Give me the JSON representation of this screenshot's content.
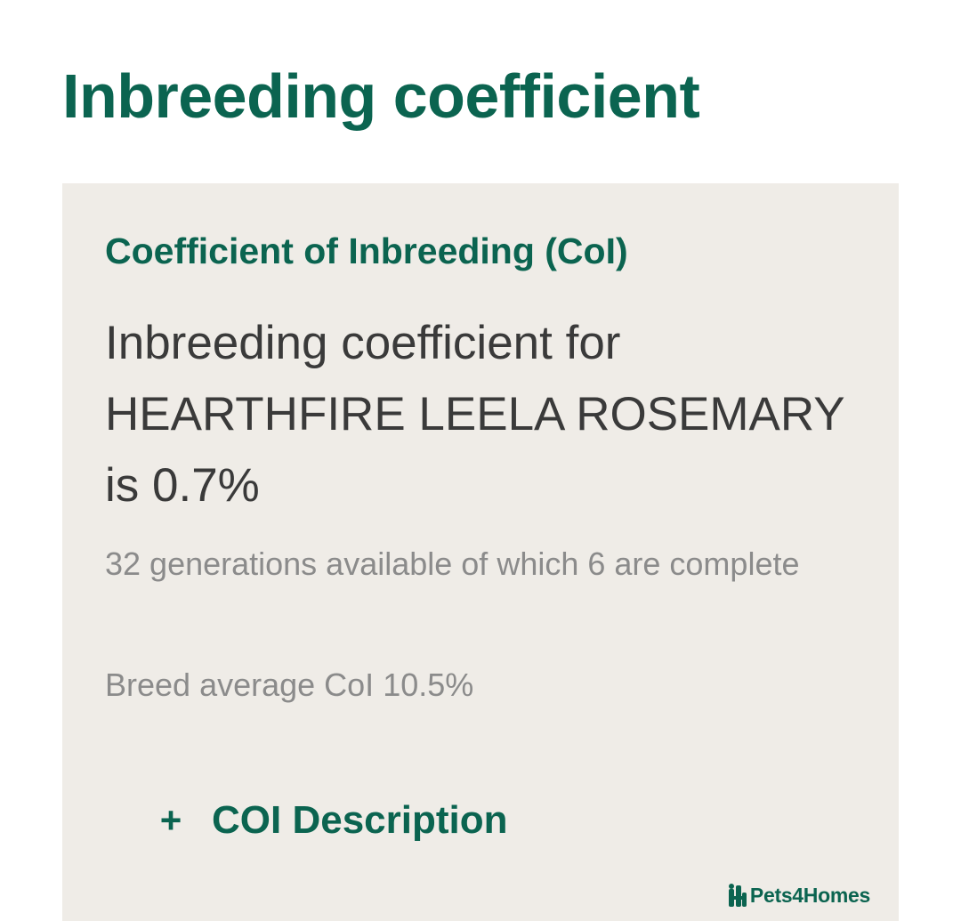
{
  "page": {
    "title": "Inbreeding coefficient"
  },
  "card": {
    "heading": "Coefficient of Inbreeding (CoI)",
    "statement": "Inbreeding coefficient for HEARTHFIRE LEELA ROSEMARY is 0.7%",
    "generations": "32 generations available of which 6 are complete",
    "breed_average": "Breed average CoI 10.5%",
    "description_toggle": {
      "icon": "plus-icon",
      "symbol": "+",
      "label": "COI Description"
    }
  },
  "watermark": {
    "text": "Pets4Homes",
    "icon": "pets4homes-logo-icon"
  },
  "colors": {
    "brand_green": "#0b6450",
    "card_background": "#efece7",
    "body_text": "#3a3a3a",
    "muted_text": "#8b8b8b"
  }
}
